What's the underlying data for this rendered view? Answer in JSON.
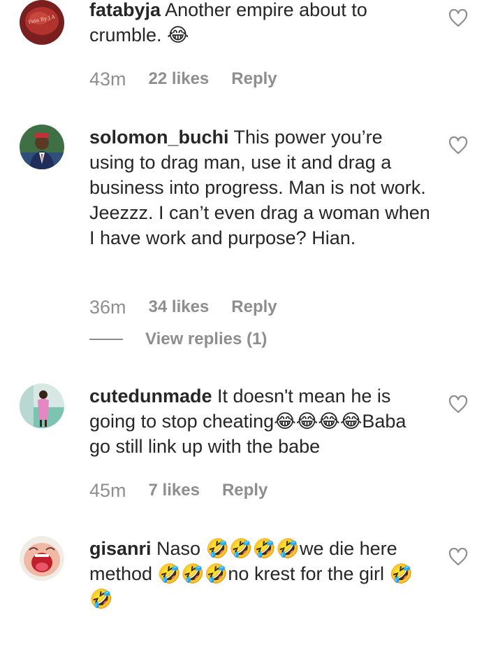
{
  "colors": {
    "text": "#262626",
    "muted": "#8e8e8e",
    "background": "#ffffff"
  },
  "comments": [
    {
      "username": "fatabyja",
      "text": "Another empire about to crumble. 😂",
      "time": "43m",
      "likes": "22 likes",
      "reply": "Reply",
      "avatar_label": "Fata By J.A"
    },
    {
      "username": "solomon_buchi",
      "text": "This power you’re using to drag man, use it and drag a business into progress. Man is not work. Jeezzz. I can’t even drag a woman when I have work and purpose? Hian.",
      "time": "36m",
      "likes": "34 likes",
      "reply": "Reply",
      "view_replies": "View replies (1)"
    },
    {
      "username": "cutedunmade",
      "text": "It doesn't mean he is going to stop cheating😂😂😂😂Baba go still link up with the babe",
      "time": "45m",
      "likes": "7 likes",
      "reply": "Reply"
    },
    {
      "username": "gisanri",
      "text": "Naso 🤣🤣🤣🤣we die here method 🤣🤣🤣no krest for the girl 🤣🤣"
    }
  ]
}
